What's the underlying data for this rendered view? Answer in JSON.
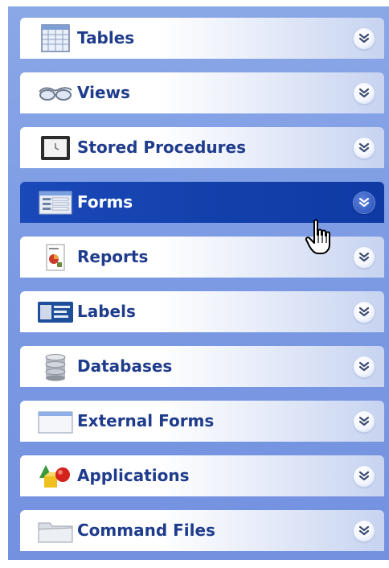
{
  "panel": {
    "items": [
      {
        "label": "Tables",
        "icon": "table-grid-icon",
        "active": false
      },
      {
        "label": "Views",
        "icon": "glasses-icon",
        "active": false
      },
      {
        "label": "Stored Procedures",
        "icon": "slate-icon",
        "active": false
      },
      {
        "label": "Forms",
        "icon": "form-icon",
        "active": true
      },
      {
        "label": "Reports",
        "icon": "report-icon",
        "active": false
      },
      {
        "label": "Labels",
        "icon": "label-card-icon",
        "active": false
      },
      {
        "label": "Databases",
        "icon": "database-icon",
        "active": false
      },
      {
        "label": "External Forms",
        "icon": "window-icon",
        "active": false
      },
      {
        "label": "Applications",
        "icon": "shapes-icon",
        "active": false
      },
      {
        "label": "Command Files",
        "icon": "folder-icon",
        "active": false
      }
    ]
  },
  "colors": {
    "panel_background": "#7b9ae3",
    "active_bar": "#1341ac",
    "label_text": "#1f3c8c",
    "active_label_text": "#ffffff"
  },
  "cursor": {
    "icon": "hand-pointer-icon"
  }
}
